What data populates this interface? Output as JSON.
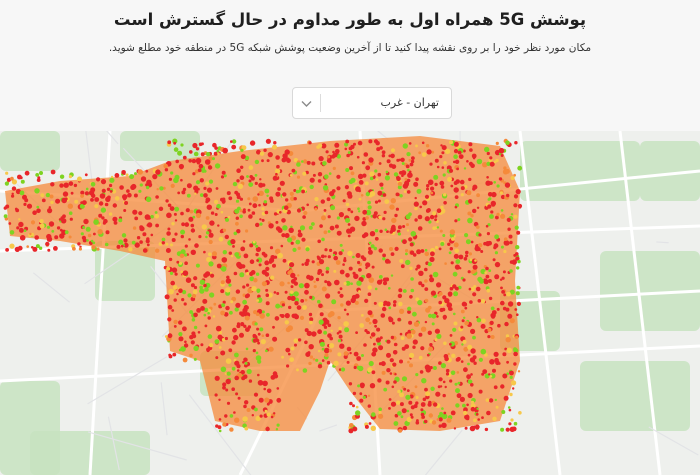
{
  "header": {
    "title": "پوشش 5G همراه اول به طور مداوم در حال گسترش است",
    "subtitle": "مکان مورد نظر خود را بر روی نقشه پیدا کنید تا از آخرین وضعیت پوشش شبکه 5G در منطقه خود مطلع شوید."
  },
  "region_select": {
    "selected": "تهران - غرب",
    "icon": "chevron-down-icon"
  },
  "map": {
    "region": "tehran-west",
    "coverage_colors": {
      "weak": "#e8262a",
      "medium": "#f58a3a",
      "good": "#f7c84a",
      "excellent": "#7ed321"
    },
    "base_colors": {
      "land": "#eef0ed",
      "green": "#c7e3bf",
      "road": "#ffffff",
      "minor_road": "#e2e3e6"
    }
  }
}
